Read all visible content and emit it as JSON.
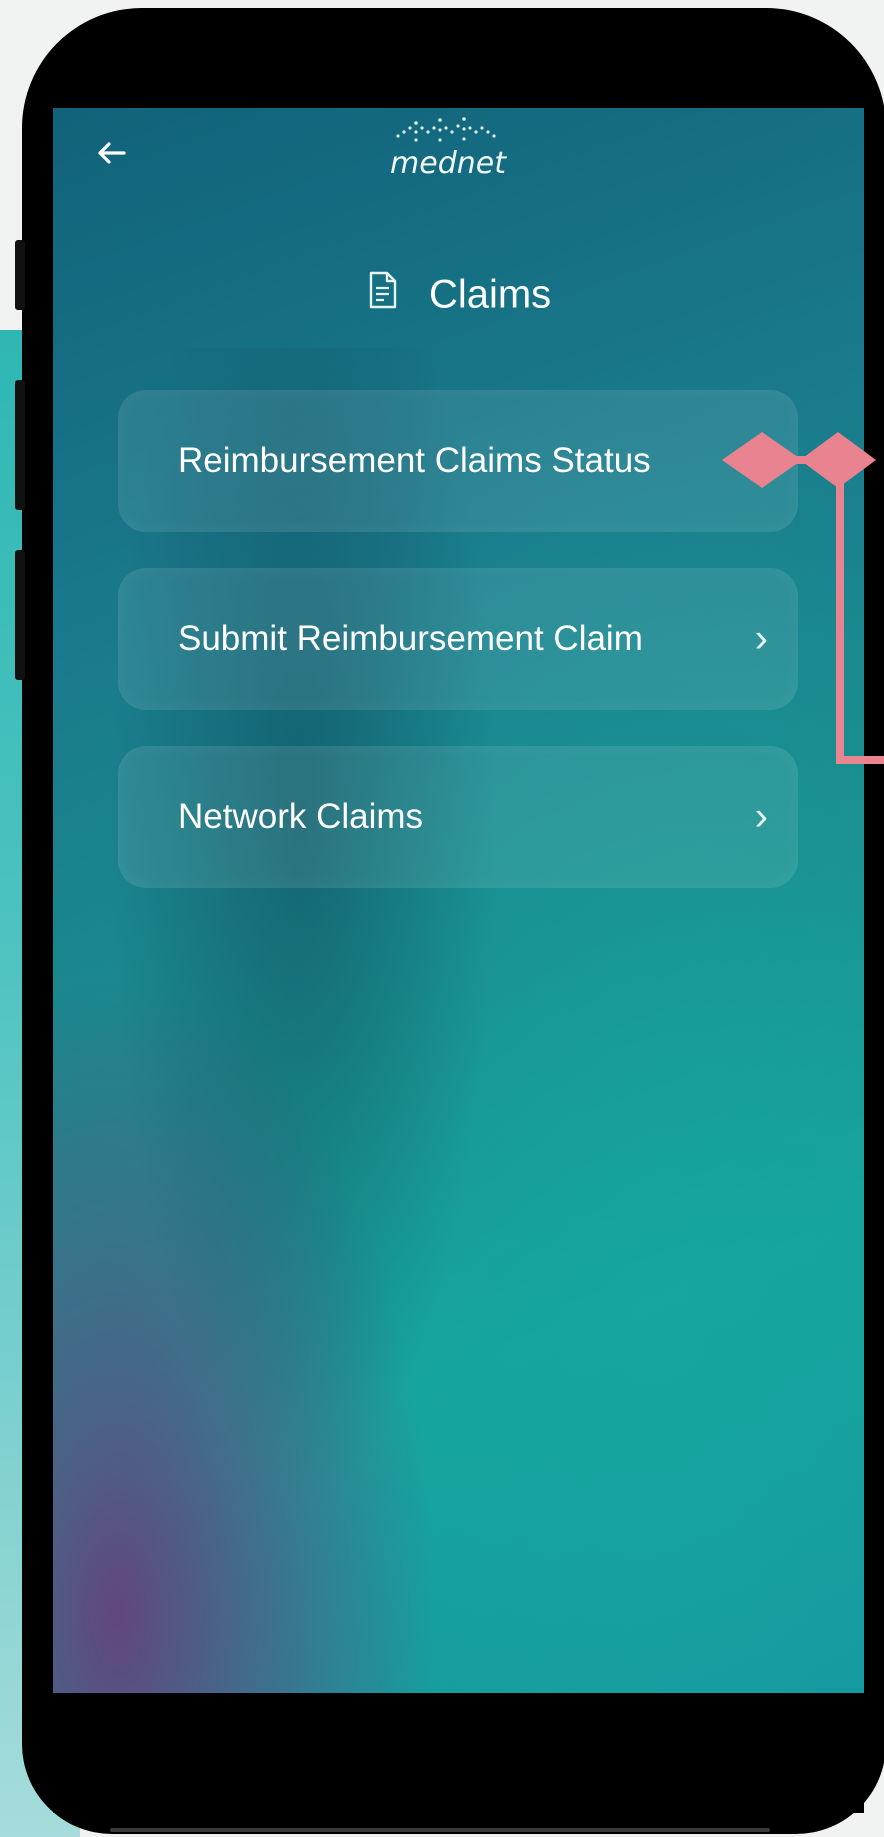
{
  "header": {
    "back_icon": "arrow-left-icon",
    "logo_text": "mednet",
    "page_icon": "document-icon",
    "page_title": "Claims"
  },
  "menu": {
    "items": [
      {
        "label": "Reimbursement Claims Status",
        "chevron": ""
      },
      {
        "label": "Submit Reimbursement Claim",
        "chevron": "›"
      },
      {
        "label": "Network Claims",
        "chevron": "›"
      }
    ]
  },
  "annotation": {
    "color": "#e8838f",
    "target": "Reimbursement Claims Status"
  },
  "theme": {
    "screen_bg_primary": "#137082",
    "screen_bg_teal": "#17a39c",
    "screen_bg_purple": "#6e3778",
    "side_band": "#2fb7b3",
    "text": "#ffffff"
  }
}
